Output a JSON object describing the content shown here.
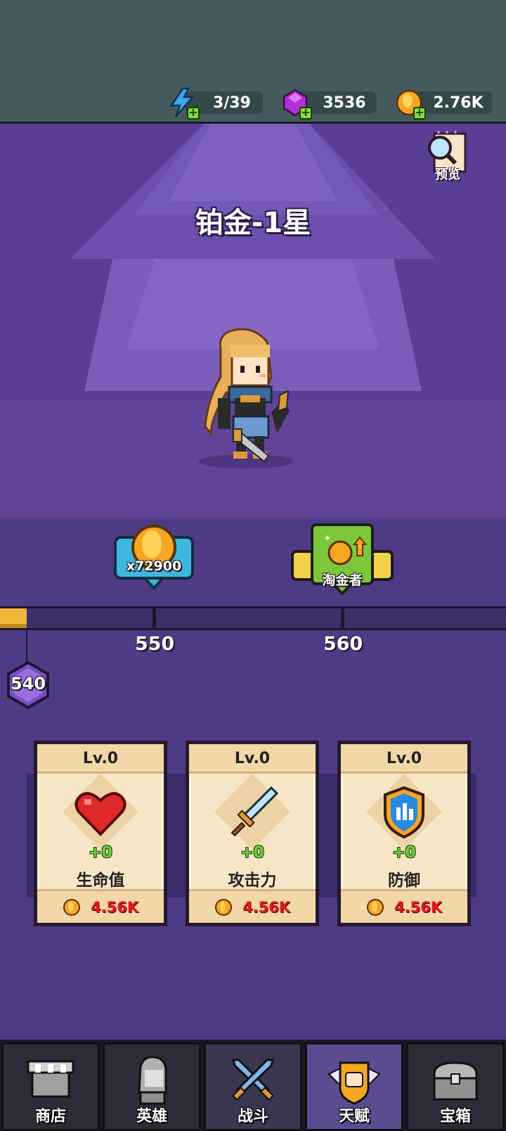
{
  "resources": {
    "energy": {
      "value": "3/39",
      "icon": "lightning-icon"
    },
    "gems": {
      "value": "3536",
      "icon": "gem-icon"
    },
    "gold": {
      "value": "2.76K",
      "icon": "gold-coin-icon"
    }
  },
  "stage": {
    "rank_title": "铂金-1星",
    "preview_label": "预览"
  },
  "rewards": [
    {
      "label": "x72900",
      "icon": "gold-coin-icon"
    },
    {
      "label": "淘金者",
      "icon": "gold-digger-icon"
    }
  ],
  "progress": {
    "current_level": "540",
    "milestones": [
      "550",
      "560"
    ],
    "fill_fraction": 0.053
  },
  "cards": [
    {
      "level": "Lv.0",
      "bonus": "+0",
      "name": "生命值",
      "cost": "4.56K",
      "icon": "heart-icon"
    },
    {
      "level": "Lv.0",
      "bonus": "+0",
      "name": "攻击力",
      "cost": "4.56K",
      "icon": "sword-icon"
    },
    {
      "level": "Lv.0",
      "bonus": "+0",
      "name": "防御",
      "cost": "4.56K",
      "icon": "shield-icon"
    }
  ],
  "nav": [
    {
      "label": "商店",
      "icon": "shop-icon"
    },
    {
      "label": "英雄",
      "icon": "hero-icon"
    },
    {
      "label": "战斗",
      "icon": "crossed-swords-icon"
    },
    {
      "label": "天赋",
      "icon": "fist-icon"
    },
    {
      "label": "宝箱",
      "icon": "chest-icon"
    }
  ],
  "colors": {
    "background": "#4f3a86",
    "topbar": "#455a5c",
    "progress_fill": "#f3b43a",
    "cost_text": "#e8161e",
    "bonus_text": "#6cd13a"
  }
}
